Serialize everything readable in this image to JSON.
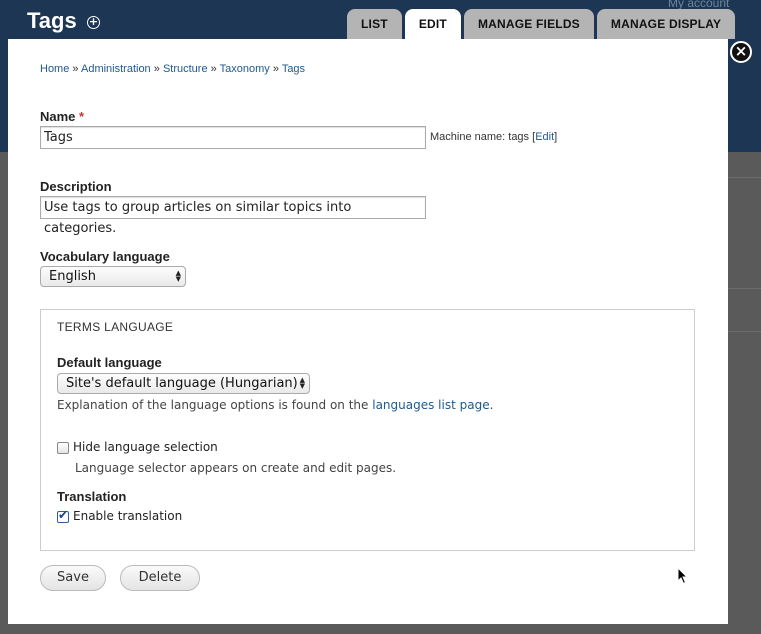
{
  "header": {
    "title": "Tags",
    "my_account": "My account",
    "tabs": [
      {
        "label": "LIST",
        "active": false
      },
      {
        "label": "EDIT",
        "active": true
      },
      {
        "label": "MANAGE FIELDS",
        "active": false
      },
      {
        "label": "MANAGE DISPLAY",
        "active": false
      }
    ]
  },
  "breadcrumb": {
    "items": [
      "Home",
      "Administration",
      "Structure",
      "Taxonomy",
      "Tags"
    ],
    "separator": "»"
  },
  "form": {
    "name": {
      "label": "Name",
      "required_marker": "*",
      "value": "Tags",
      "machine_name_prefix": "Machine name: tags",
      "machine_name_edit": "Edit"
    },
    "description": {
      "label": "Description",
      "value": "Use tags to group articles on similar topics into categories."
    },
    "vocabulary_language": {
      "label": "Vocabulary language",
      "selected": "English"
    },
    "terms_language": {
      "legend": "TERMS LANGUAGE",
      "default_language_label": "Default language",
      "default_language_selected": "Site's default language (Hungarian)",
      "explanation_text": "Explanation of the language options is found on the",
      "explanation_link": "languages list page",
      "explanation_end": ".",
      "hide_selection_label": "Hide language selection",
      "hide_selection_checked": false,
      "hide_selection_desc": "Language selector appears on create and edit pages.",
      "translation_label": "Translation",
      "enable_translation_label": "Enable translation",
      "enable_translation_checked": true
    },
    "buttons": {
      "save": "Save",
      "delete": "Delete"
    }
  },
  "colors": {
    "header_bg": "#1c3654",
    "link": "#1c5a91",
    "tab_bg": "#b4b4b4",
    "tab_active_bg": "#ffffff"
  }
}
